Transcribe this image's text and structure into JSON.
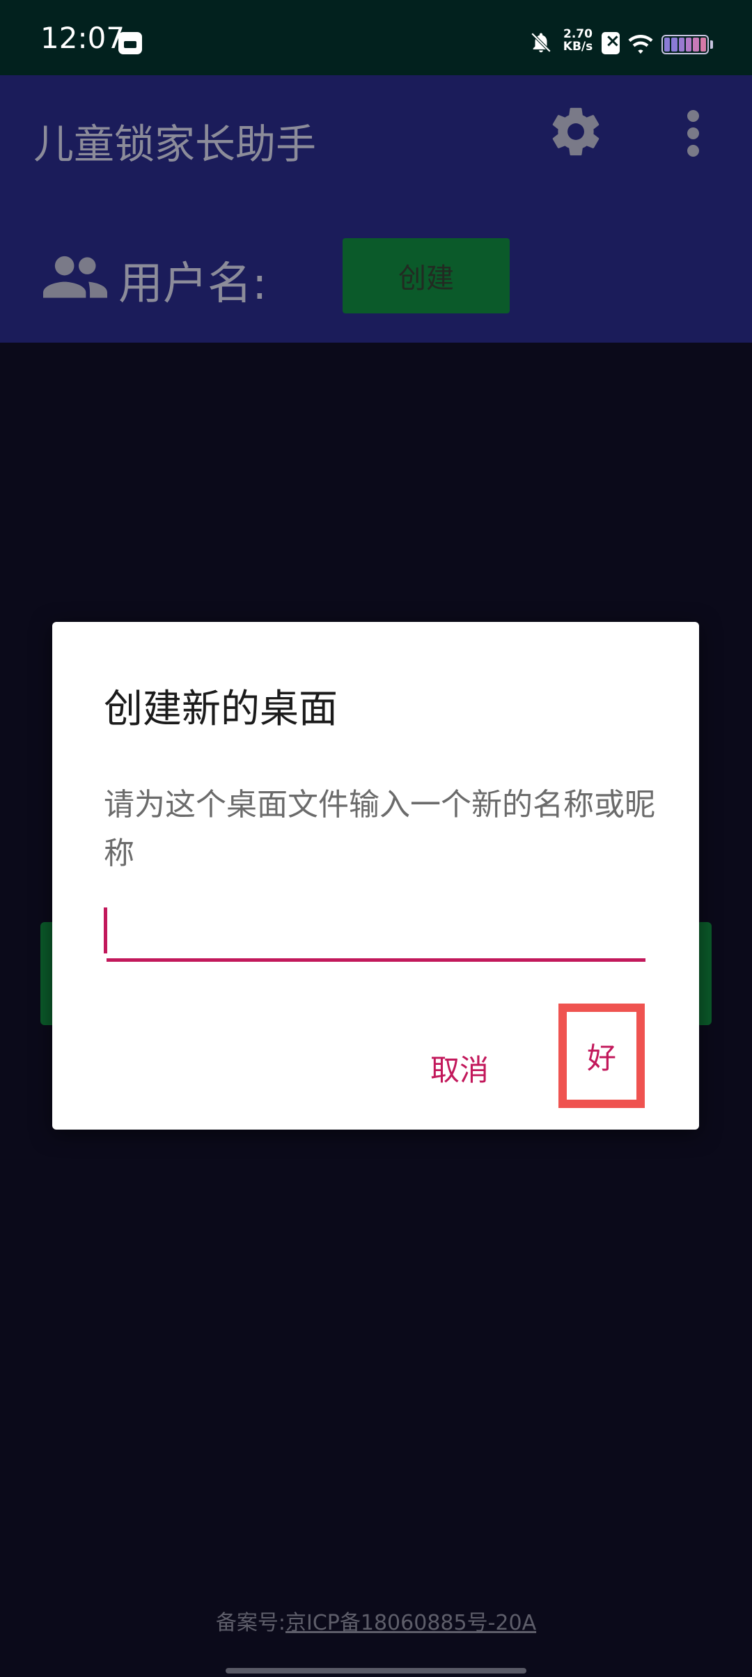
{
  "status_bar": {
    "time": "12:07",
    "net_speed_value": "2.70",
    "net_speed_unit": "KB/s",
    "battery_colors": [
      "#8a7bd6",
      "#8a7bd6",
      "#9a7ad0",
      "#b47ac8",
      "#c77ab8",
      "#d67aa8"
    ]
  },
  "app_bar": {
    "title": "儿童锁家长助手",
    "username_label": "用户名:",
    "create_button_label": "创建"
  },
  "dialog": {
    "title": "创建新的桌面",
    "message": "请为这个桌面文件输入一个新的名称或昵称",
    "input_value": "",
    "cancel_label": "取消",
    "ok_label": "好"
  },
  "footer": {
    "prefix": "备案号:",
    "link_text": "京ICP备18060885号-20A"
  },
  "colors": {
    "status_bar_bg": "#02211e",
    "app_bar_bg": "#1b1c5a",
    "accent": "#c2185b",
    "highlight": "#ef5350",
    "create_button_bg": "#0b5a2a"
  }
}
